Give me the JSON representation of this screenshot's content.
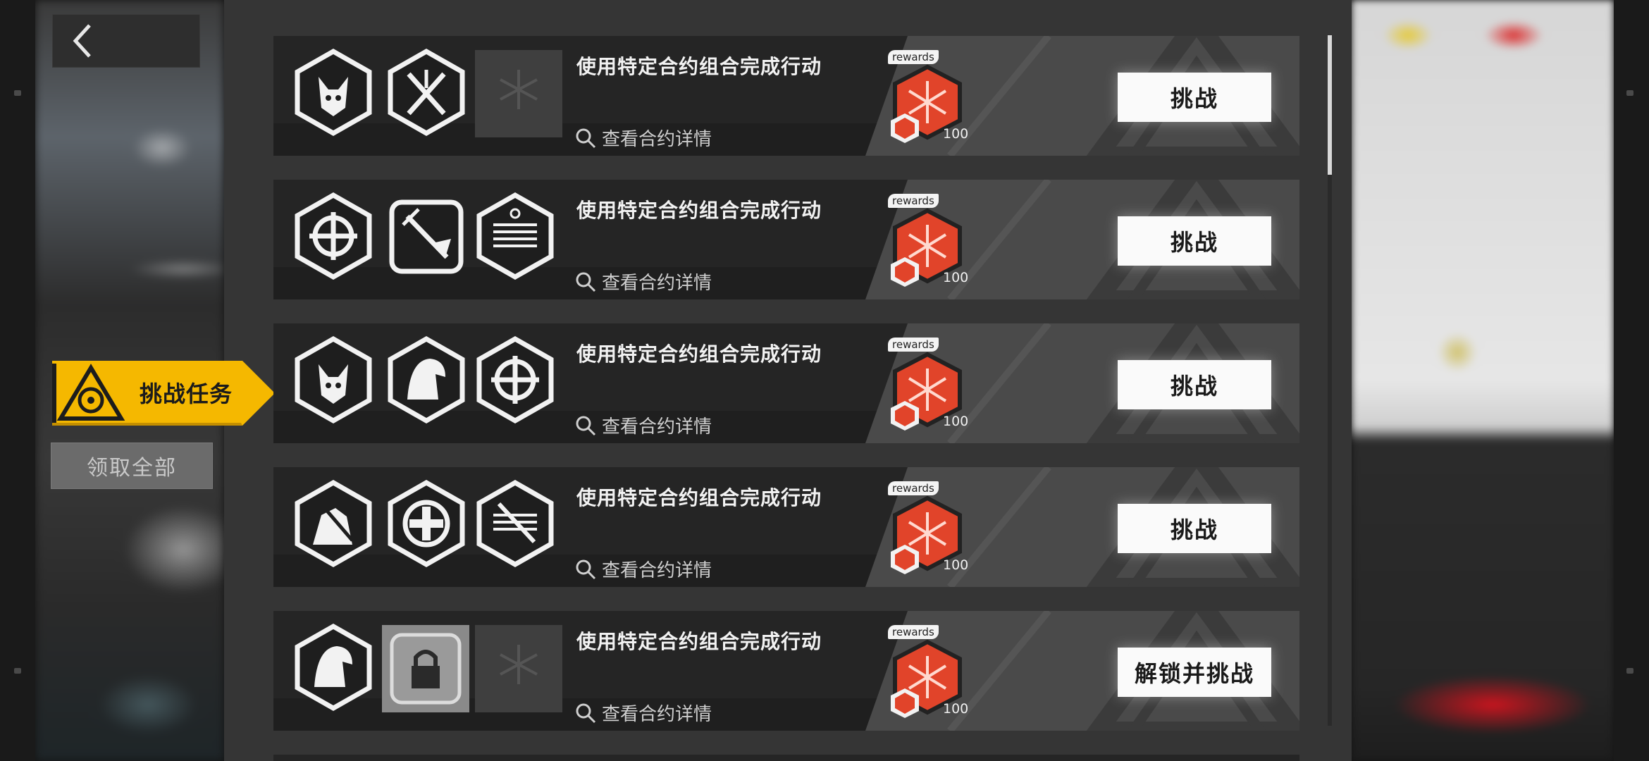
{
  "tab": {
    "label": "挑战任务"
  },
  "claim_all_label": "领取全部",
  "tasks": [
    {
      "title": "使用特定合约组合完成行动",
      "details": "查看合约详情",
      "reward_tag": "rewards",
      "reward_count": "100",
      "button": "挑战",
      "slots": [
        "masked-warrior-icon",
        "crossed-swords-icon",
        "empty-contract-slot"
      ]
    },
    {
      "title": "使用特定合约组合完成行动",
      "details": "查看合约详情",
      "reward_tag": "rewards",
      "reward_count": "100",
      "button": "挑战",
      "slots": [
        "crosshair-icon",
        "sword-dagger-icon",
        "document-contract-icon"
      ]
    },
    {
      "title": "使用特定合约组合完成行动",
      "details": "查看合约详情",
      "reward_tag": "rewards",
      "reward_count": "100",
      "button": "挑战",
      "slots": [
        "masked-warrior-icon",
        "hooded-figure-icon",
        "crosshair-icon"
      ]
    },
    {
      "title": "使用特定合约组合完成行动",
      "details": "查看合约详情",
      "reward_tag": "rewards",
      "reward_count": "100",
      "button": "挑战",
      "slots": [
        "knight-icon",
        "medical-cross-icon",
        "sword-document-icon"
      ]
    },
    {
      "title": "使用特定合约组合完成行动",
      "details": "查看合约详情",
      "reward_tag": "rewards",
      "reward_count": "100",
      "button": "解锁并挑战",
      "slots": [
        "hooded-figure-icon",
        "padlock-icon",
        "empty-contract-slot"
      ]
    }
  ],
  "colors": {
    "accent_yellow": "#f5b800",
    "panel": "#353535",
    "card": "#252525",
    "reward_red": "#e1442a"
  }
}
